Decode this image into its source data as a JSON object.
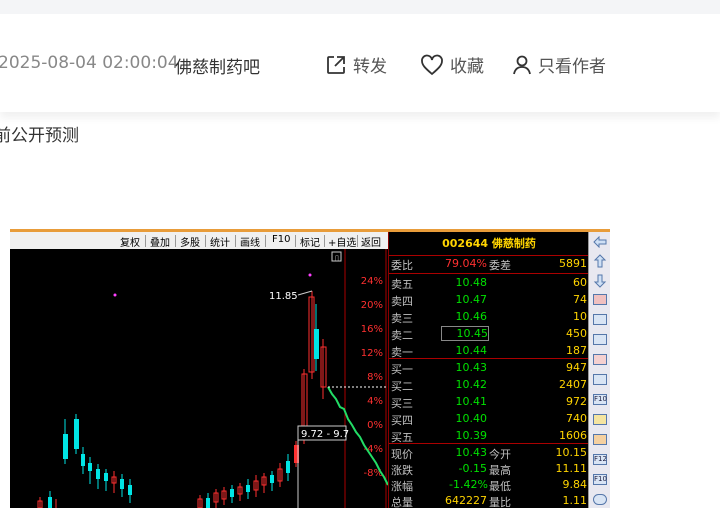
{
  "post": {
    "date": "2025-08-04 02:00:04",
    "forum": "佛慈制药吧",
    "actions": {
      "share": "转发",
      "favorite": "收藏",
      "author_only": "只看作者"
    },
    "text": "前公开预测"
  },
  "toolbar": [
    "复权",
    "叠加",
    "多股",
    "统计",
    "画线",
    "F10",
    "标记",
    "+自选",
    "返回"
  ],
  "chart": {
    "high_label": "11.85",
    "range_label": "9.72 - 9.7",
    "pct_ticks": [
      "24%",
      "20%",
      "16%",
      "12%",
      "8%",
      "4%",
      "0%",
      "-4%",
      "-8%"
    ]
  },
  "quote": {
    "title": "002644 佛慈制药",
    "weibi_label": "委比",
    "weibi": "79.04%",
    "weicha_label": "委差",
    "weicha": "5891",
    "asks": [
      {
        "label": "卖五",
        "price": "10.48",
        "vol": "60"
      },
      {
        "label": "卖四",
        "price": "10.47",
        "vol": "74"
      },
      {
        "label": "卖三",
        "price": "10.46",
        "vol": "10"
      },
      {
        "label": "卖二",
        "price": "10.45",
        "vol": "450"
      },
      {
        "label": "卖一",
        "price": "10.44",
        "vol": "187"
      }
    ],
    "bids": [
      {
        "label": "买一",
        "price": "10.43",
        "vol": "947"
      },
      {
        "label": "买二",
        "price": "10.42",
        "vol": "2407"
      },
      {
        "label": "买三",
        "price": "10.41",
        "vol": "972"
      },
      {
        "label": "买四",
        "price": "10.40",
        "vol": "740"
      },
      {
        "label": "买五",
        "price": "10.39",
        "vol": "1606"
      }
    ],
    "stats": [
      {
        "l1": "现价",
        "v1": "10.43",
        "l2": "今开",
        "v2": "10.15"
      },
      {
        "l1": "涨跌",
        "v1": "-0.15",
        "l2": "最高",
        "v2": "11.11"
      },
      {
        "l1": "涨幅",
        "v1": "-1.42%",
        "l2": "最低",
        "v2": "9.84"
      },
      {
        "l1": "总量",
        "v1": "642227",
        "l2": "量比",
        "v2": "1.11"
      }
    ]
  },
  "sidebar_icons": [
    "arrow-up-icon",
    "arrow-up-outline-icon",
    "arrow-down-outline-icon",
    "color-grid-icon",
    "table-icon",
    "line-chart-icon",
    "candle-icon",
    "list-icon",
    "f10-icon",
    "bar-icon",
    "calendar-icon",
    "f12-icon",
    "f10-circle-icon",
    "circle-icon"
  ]
}
